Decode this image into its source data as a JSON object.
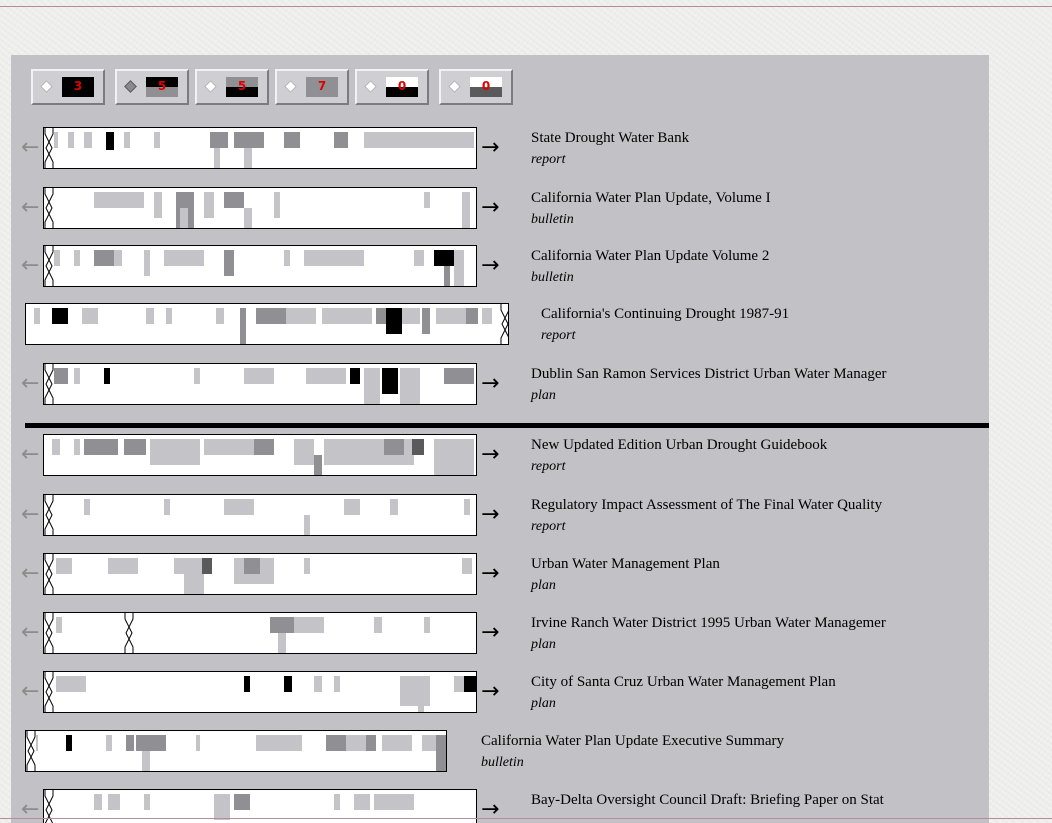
{
  "colors": {
    "panel": "#c2c1c6",
    "bar_bg": "#ffffff",
    "tile_light": "#c4c4c8",
    "tile_mid": "#909094",
    "tile_dark": "#5a5a5c",
    "tile_black": "#000000",
    "toolbar_number": "#e00000"
  },
  "toolbar": [
    {
      "number": "3",
      "selected": false,
      "top_color": "#000000",
      "bottom_color": "#000000",
      "icon": "term-weight-swatch"
    },
    {
      "number": "5",
      "selected": true,
      "top_color": "#000000",
      "bottom_color": "#909094",
      "icon": "term-weight-swatch"
    },
    {
      "number": "5",
      "selected": false,
      "top_color": "#909094",
      "bottom_color": "#000000",
      "icon": "term-weight-swatch"
    },
    {
      "number": "7",
      "selected": false,
      "top_color": "#909094",
      "bottom_color": "#909094",
      "icon": "term-weight-swatch"
    },
    {
      "number": "0",
      "selected": false,
      "top_color": "#ffffff",
      "bottom_color": "#000000",
      "icon": "term-weight-swatch"
    },
    {
      "number": "0",
      "selected": false,
      "top_color": "#ffffff",
      "bottom_color": "#5a5a5c",
      "icon": "term-weight-swatch"
    }
  ],
  "results": [
    {
      "title": "State Drought Water Bank",
      "type": "report"
    },
    {
      "title": "California Water Plan Update, Volume I",
      "type": "bulletin"
    },
    {
      "title": "California Water Plan Update  Volume 2",
      "type": "bulletin"
    },
    {
      "title": "California's Continuing Drought 1987-91",
      "type": "report"
    },
    {
      "title": "Dublin San Ramon Services District Urban Water Manager",
      "type": "plan"
    },
    {
      "title": "New Updated Edition Urban Drought Guidebook",
      "type": "report"
    },
    {
      "title": "Regulatory Impact Assessment of The Final Water Quality",
      "type": "report"
    },
    {
      "title": "Urban Water Management Plan",
      "type": "plan"
    },
    {
      "title": "Irvine Ranch Water District 1995 Urban Water Managemer",
      "type": "plan"
    },
    {
      "title": "City of Santa Cruz Urban Water Management Plan",
      "type": "plan"
    },
    {
      "title": "California Water Plan Update  Executive Summary",
      "type": "bulletin"
    },
    {
      "title": "Bay-Delta Oversight Council Draft: Briefing Paper on Stat",
      "type": ""
    }
  ]
}
